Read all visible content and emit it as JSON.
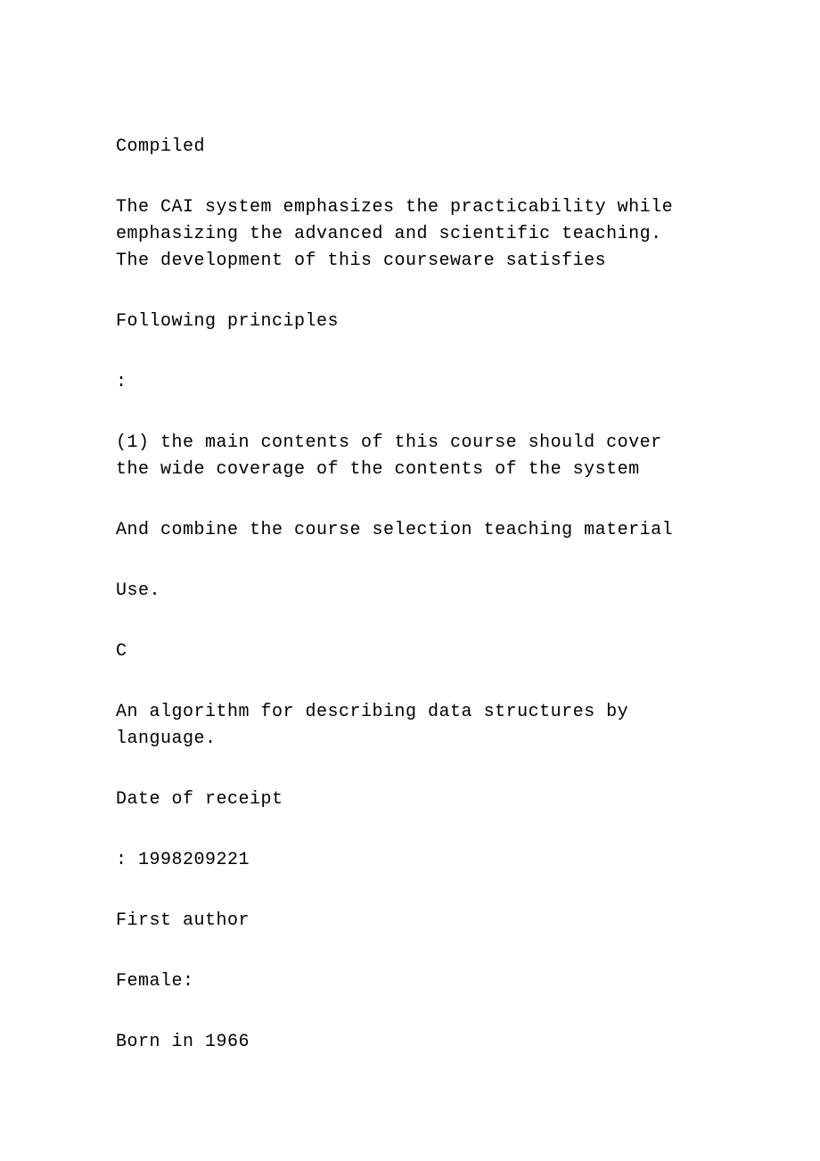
{
  "paragraphs": [
    "Compiled",
    "The CAI system emphasizes the practicability while emphasizing the advanced and scientific teaching. The development of this courseware satisfies",
    "Following principles",
    ":",
    "(1) the main contents of this course should cover the wide coverage of the contents of the system",
    "And combine the course selection teaching material",
    "Use.",
    "C",
    "An algorithm for describing data structures by language.",
    "Date of receipt",
    ": 1998209221",
    "First author",
    "Female:",
    "Born in 1966"
  ]
}
